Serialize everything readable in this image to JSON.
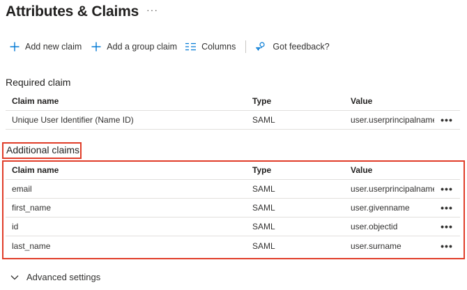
{
  "page": {
    "title": "Attributes & Claims",
    "more_glyph": "···"
  },
  "toolbar": {
    "add_new_claim": "Add new claim",
    "add_group_claim": "Add a group claim",
    "columns": "Columns",
    "feedback": "Got feedback?"
  },
  "required": {
    "heading": "Required claim",
    "columns": {
      "name": "Claim name",
      "type": "Type",
      "value": "Value"
    },
    "rows": [
      {
        "name": "Unique User Identifier (Name ID)",
        "type": "SAML",
        "value": "user.userprincipalname [..."
      }
    ]
  },
  "additional": {
    "heading": "Additional claims",
    "columns": {
      "name": "Claim name",
      "type": "Type",
      "value": "Value"
    },
    "rows": [
      {
        "name": "email",
        "type": "SAML",
        "value": "user.userprincipalname"
      },
      {
        "name": "first_name",
        "type": "SAML",
        "value": "user.givenname"
      },
      {
        "name": "id",
        "type": "SAML",
        "value": "user.objectid"
      },
      {
        "name": "last_name",
        "type": "SAML",
        "value": "user.surname"
      }
    ]
  },
  "row_more_glyph": "•••",
  "advanced": {
    "label": "Advanced settings"
  },
  "colors": {
    "accent": "#0078d4",
    "highlight": "#e03c28"
  },
  "icons": [
    "more-icon",
    "plus-icon",
    "columns-icon",
    "feedback-icon",
    "row-more-icon",
    "chevron-down-icon"
  ]
}
